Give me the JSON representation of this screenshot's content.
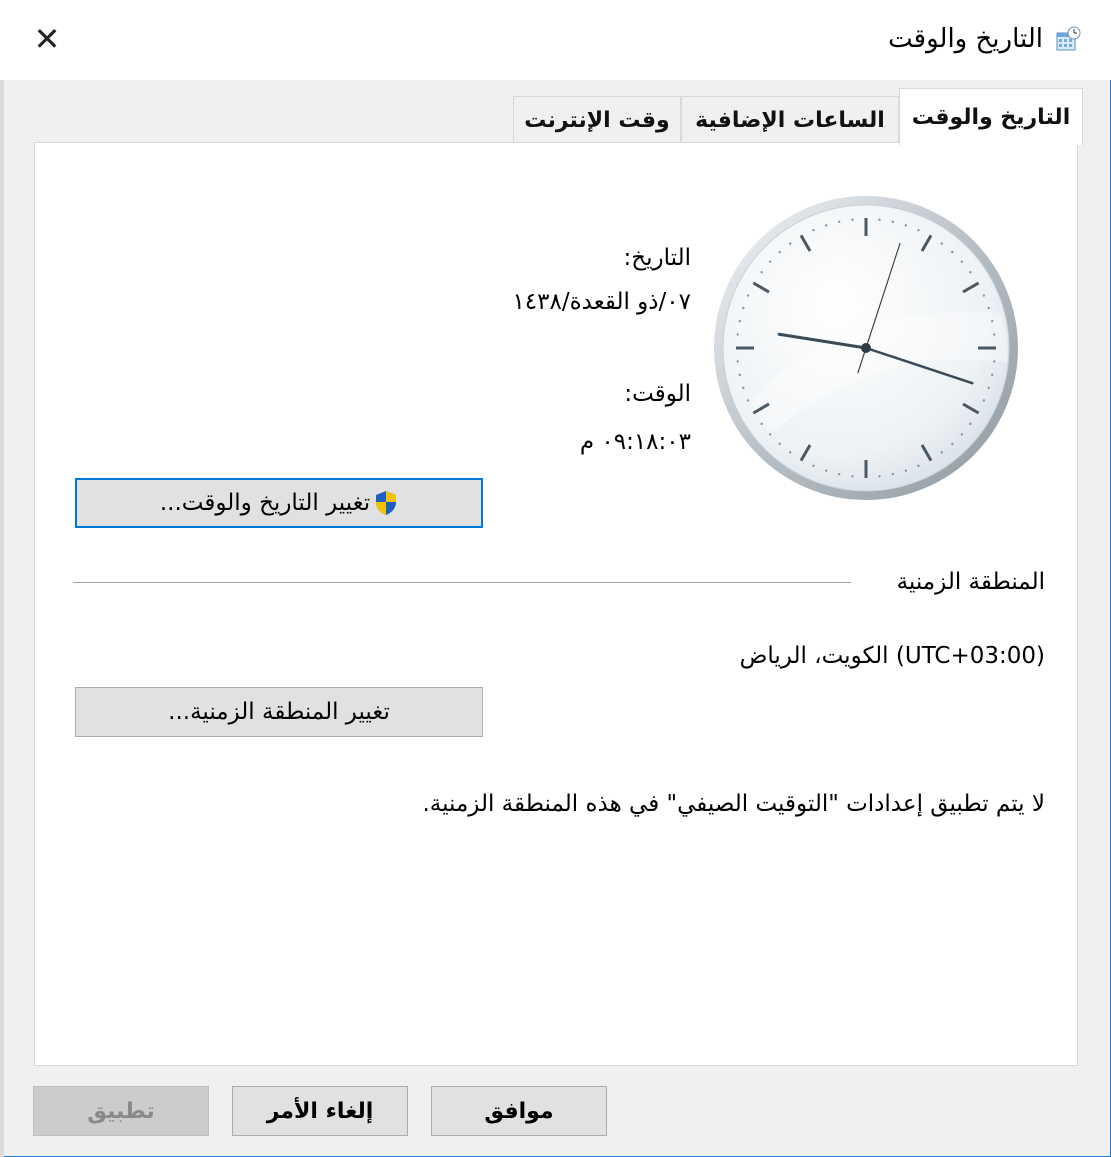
{
  "window": {
    "title": "التاريخ والوقت",
    "close_glyph": "✕"
  },
  "tabs": [
    {
      "label": "التاريخ والوقت",
      "active": true
    },
    {
      "label": "الساعات الإضافية",
      "active": false
    },
    {
      "label": "وقت الإنترنت",
      "active": false
    }
  ],
  "datetime": {
    "date_label": "التاريخ:",
    "date_value": "٠٧/ذو القعدة/١٤٣٨",
    "time_label": "الوقت:",
    "time_value": "٠٩:١٨:٠٣ م",
    "change_button": "تغيير التاريخ والوقت..."
  },
  "clock": {
    "hour": 9,
    "minute": 18,
    "second": 3
  },
  "timezone": {
    "heading": "المنطقة الزمنية",
    "value": "(UTC+03:00) الكويت، الرياض",
    "change_button": "تغيير المنطقة الزمنية...",
    "dst_note": "لا يتم تطبيق إعدادات \"التوقيت الصيفي\" في هذه المنطقة الزمنية."
  },
  "footer": {
    "ok": "موافق",
    "cancel": "إلغاء الأمر",
    "apply": "تطبيق"
  },
  "colors": {
    "accent": "#0078d7",
    "panel": "#ffffff",
    "chrome": "#f0f0f0"
  },
  "icons": {
    "title": "clock-calendar-icon",
    "uac": "shield-icon"
  }
}
